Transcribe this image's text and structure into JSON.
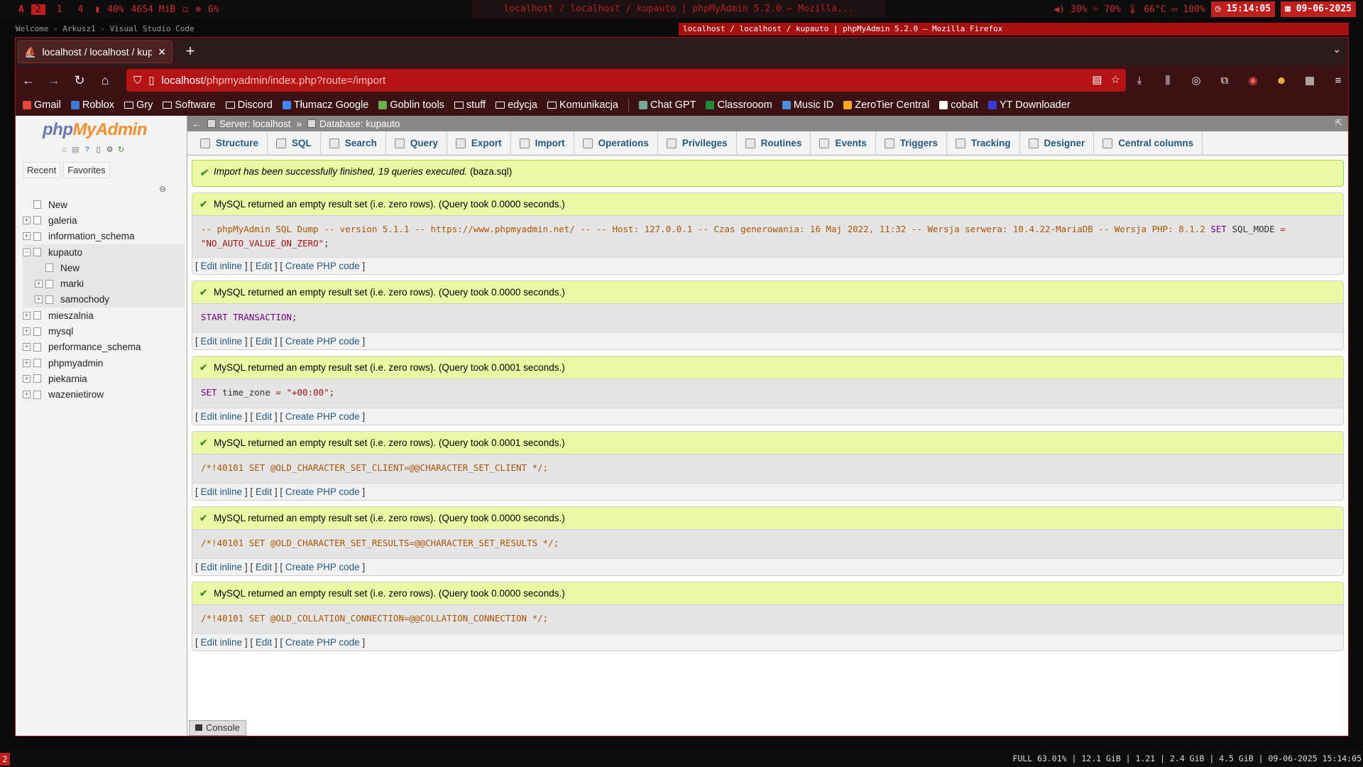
{
  "sysbar": {
    "workspaces": [
      "2",
      "1",
      "4"
    ],
    "active_workspace": "2",
    "cpu": "40%",
    "memory": "4654 MiB",
    "disk": "6%",
    "window_title": "localhost / localhost / kupauto | phpMyAdmin 5.2.0 — Mozilla...",
    "volume": "30%",
    "brightness": "70%",
    "temp": "66°C",
    "battery": "100%",
    "time": "15:14:05",
    "date": "09-06-2025"
  },
  "windows": {
    "left": "Welcome - Arkusz1 - Visual Studio Code",
    "right": "localhost / localhost / kupauto | phpMyAdmin 5.2.0 — Mozilla Firefox"
  },
  "browser": {
    "tab_title": "localhost / localhost / kupa",
    "url_host": "localhost",
    "url_path": "/phpmyadmin/index.php?route=/import",
    "bookmarks": [
      {
        "label": "Gmail",
        "icon": "gmail-icon",
        "color": "#ea4335"
      },
      {
        "label": "Roblox",
        "icon": "roblox-icon",
        "color": "#3a7bd5"
      },
      {
        "label": "Gry",
        "icon": "folder-icon",
        "color": ""
      },
      {
        "label": "Software",
        "icon": "folder-icon",
        "color": ""
      },
      {
        "label": "Discord",
        "icon": "folder-icon",
        "color": ""
      },
      {
        "label": "Tłumacz Google",
        "icon": "translate-icon",
        "color": "#4285f4"
      },
      {
        "label": "Goblin tools",
        "icon": "goblin-icon",
        "color": "#6ab04c"
      },
      {
        "label": "stuff",
        "icon": "folder-icon",
        "color": ""
      },
      {
        "label": "edycja",
        "icon": "folder-icon",
        "color": ""
      },
      {
        "label": "Komunikacja",
        "icon": "folder-icon",
        "color": ""
      },
      {
        "label": "Chat GPT",
        "icon": "chatgpt-icon",
        "color": "#74aa9c"
      },
      {
        "label": "Classrooom",
        "icon": "classroom-icon",
        "color": "#1e8e3e"
      },
      {
        "label": "Music ID",
        "icon": "music-icon",
        "color": "#4a90e2"
      },
      {
        "label": "ZeroTier Central",
        "icon": "zerotier-icon",
        "color": "#f5a623"
      },
      {
        "label": "cobalt",
        "icon": "cobalt-icon",
        "color": "#ffffff"
      },
      {
        "label": "YT Downloader",
        "icon": "yt-icon",
        "color": "#3a3ad5"
      }
    ]
  },
  "pma": {
    "logo_php": "php",
    "logo_rest": "MyAdmin",
    "tabs": [
      "Recent",
      "Favorites"
    ],
    "tree": [
      {
        "label": "New",
        "level": 0,
        "expander": "",
        "selected": false
      },
      {
        "label": "galeria",
        "level": 0,
        "expander": "+",
        "selected": false
      },
      {
        "label": "information_schema",
        "level": 0,
        "expander": "+",
        "selected": false
      },
      {
        "label": "kupauto",
        "level": 0,
        "expander": "−",
        "selected": true
      },
      {
        "label": "New",
        "level": 1,
        "expander": "",
        "selected": true
      },
      {
        "label": "marki",
        "level": 1,
        "expander": "+",
        "selected": true
      },
      {
        "label": "samochody",
        "level": 1,
        "expander": "+",
        "selected": true
      },
      {
        "label": "mieszalnia",
        "level": 0,
        "expander": "+",
        "selected": false
      },
      {
        "label": "mysql",
        "level": 0,
        "expander": "+",
        "selected": false
      },
      {
        "label": "performance_schema",
        "level": 0,
        "expander": "+",
        "selected": false
      },
      {
        "label": "phpmyadmin",
        "level": 0,
        "expander": "+",
        "selected": false
      },
      {
        "label": "piekarnia",
        "level": 0,
        "expander": "+",
        "selected": false
      },
      {
        "label": "wazenietirow",
        "level": 0,
        "expander": "+",
        "selected": false
      }
    ],
    "breadcrumb": {
      "server": "Server: localhost",
      "sep": "»",
      "database": "Database: kupauto"
    },
    "menu": [
      "Structure",
      "SQL",
      "Search",
      "Query",
      "Export",
      "Import",
      "Operations",
      "Privileges",
      "Routines",
      "Events",
      "Triggers",
      "Tracking",
      "Designer",
      "Central columns"
    ],
    "import_msg": "Import has been successfully finished, 19 queries executed.",
    "import_file": "(baza.sql)",
    "actions": {
      "edit_inline": "Edit inline",
      "edit": "Edit",
      "create_php": "Create PHP code"
    },
    "results": [
      {
        "msg": "MySQL returned an empty result set (i.e. zero rows). (Query took 0.0000 seconds.)",
        "comment": "-- phpMyAdmin SQL Dump -- version 5.1.1 -- https://www.phpmyadmin.net/ -- -- Host: 127.0.0.1 -- Czas generowania: 16 Maj 2022, 11:32 -- Wersja serwera: 10.4.22-MariaDB -- Wersja PHP: 8.1.2",
        "kw": "SET",
        "rest": "SQL_MODE",
        "op": "=",
        "str": "\"NO_AUTO_VALUE_ON_ZERO\"",
        "tail": ";"
      },
      {
        "msg": "MySQL returned an empty result set (i.e. zero rows). (Query took 0.0000 seconds.)",
        "comment": "",
        "kw": "START TRANSACTION",
        "rest": "",
        "op": "",
        "str": "",
        "tail": ";"
      },
      {
        "msg": "MySQL returned an empty result set (i.e. zero rows). (Query took 0.0001 seconds.)",
        "comment": "",
        "kw": "SET",
        "rest": "time_zone",
        "op": "=",
        "str": "\"+00:00\"",
        "tail": ";"
      },
      {
        "msg": "MySQL returned an empty result set (i.e. zero rows). (Query took 0.0001 seconds.)",
        "comment": "/*!40101 SET @OLD_CHARACTER_SET_CLIENT=@@CHARACTER_SET_CLIENT */;",
        "kw": "",
        "rest": "",
        "op": "",
        "str": "",
        "tail": ""
      },
      {
        "msg": "MySQL returned an empty result set (i.e. zero rows). (Query took 0.0000 seconds.)",
        "comment": "/*!40101 SET @OLD_CHARACTER_SET_RESULTS=@@CHARACTER_SET_RESULTS */;",
        "kw": "",
        "rest": "",
        "op": "",
        "str": "",
        "tail": ""
      },
      {
        "msg": "MySQL returned an empty result set (i.e. zero rows). (Query took 0.0000 seconds.)",
        "comment": "/*!40101 SET @OLD_COLLATION_CONNECTION=@@COLLATION_CONNECTION */;",
        "kw": "",
        "rest": "",
        "op": "",
        "str": "",
        "tail": ""
      }
    ],
    "console": "Console"
  },
  "statusbar": {
    "workspace": "2",
    "text": "FULL 63.01% | 12.1 GiB | 1.21 | 2.4 GiB | 4.5 GiB | 09-06-2025 15:14:05"
  }
}
